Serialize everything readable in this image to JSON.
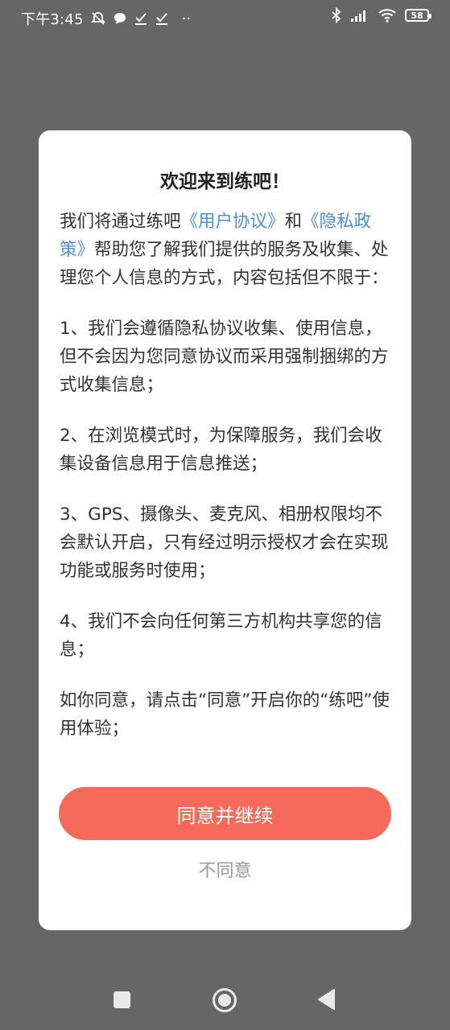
{
  "status_bar": {
    "time": "下午3:45",
    "battery": "58",
    "dots": "··"
  },
  "dialog": {
    "title": "欢迎来到练吧！",
    "intro": {
      "before": "我们将通过练吧",
      "user_agreement": "《用户协议》",
      "and": "和",
      "privacy_policy": "《隐私政策》",
      "after": "帮助您了解我们提供的服务及收集、处理您个人信息的方式，内容包括但不限于："
    },
    "item1": "1、我们会遵循隐私协议收集、使用信息，但不会因为您同意协议而采用强制捆绑的方式收集信息；",
    "item2": "2、在浏览模式时，为保障服务，我们会收集设备信息用于信息推送；",
    "item3": "3、GPS、摄像头、麦克风、相册权限均不会默认开启，只有经过明示授权才会在实现功能或服务时使用；",
    "item4": "4、我们不会向任何第三方机构共享您的信息；",
    "closing": "如你同意，请点击“同意”开启你的“练吧”使用体验；",
    "agree_button": "同意并继续",
    "disagree_button": "不同意"
  },
  "colors": {
    "overlay": "#666666",
    "link": "#4a90d9",
    "primary_button": "#f66a5a",
    "secondary_text": "#999999"
  },
  "icons": {
    "status_left": [
      "mute-bell-icon",
      "chat-bubble-icon",
      "download-check-icon",
      "download-check-icon"
    ],
    "status_right": [
      "bluetooth-icon",
      "cellular-signal-icon",
      "wifi-icon",
      "battery-icon"
    ],
    "nav": [
      "recents-square-icon",
      "home-circle-icon",
      "back-triangle-icon"
    ]
  }
}
